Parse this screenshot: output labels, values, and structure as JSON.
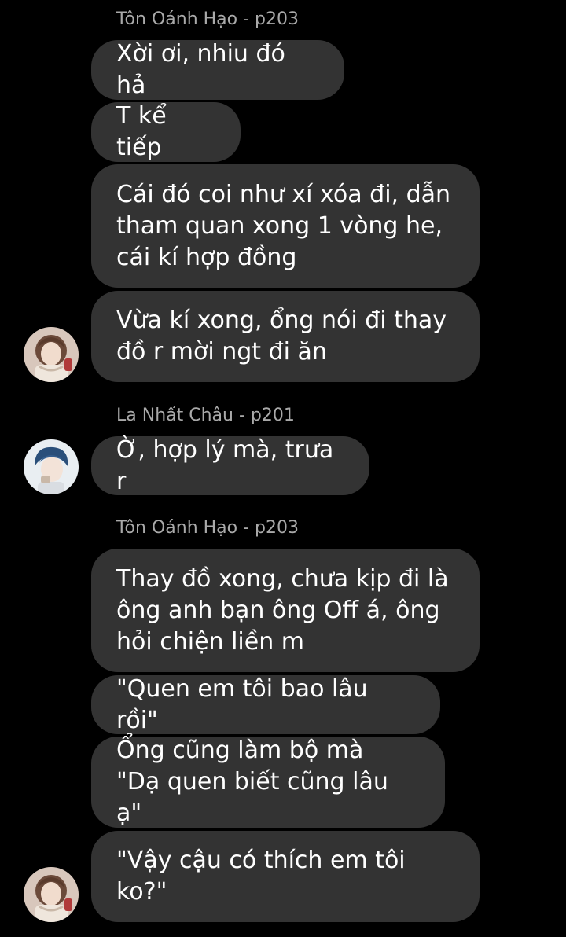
{
  "colors": {
    "background": "#000000",
    "bubble": "#333333",
    "sender_name": "#a9a9a9",
    "text": "#ffffff"
  },
  "groups": [
    {
      "sender": "Tôn Oánh Hạo - p203",
      "avatar": "avatar-girl-scarf",
      "messages": [
        "Xời ơi, nhiu đó hả",
        "T kể tiếp",
        "Cái đó coi như xí xóa đi, dẫn\ntham quan xong 1 vòng he,\ncái kí hợp đồng",
        "Vừa kí xong, ổng nói đi thay\nđồ r mời ngt đi ăn"
      ]
    },
    {
      "sender": "La Nhất Châu - p201",
      "avatar": "avatar-boy-blue-hair",
      "messages": [
        "Ờ, hợp lý mà, trưa r"
      ]
    },
    {
      "sender": "Tôn Oánh Hạo - p203",
      "avatar": "avatar-girl-scarf",
      "messages": [
        "Thay đồ xong, chưa kịp đi là\nông anh bạn ông Off á, ông\nhỏi chiện liền m",
        "\"Quen em tôi bao lâu rồi\"",
        "Ổng cũng làm bộ mà\n\"Dạ quen biết cũng lâu ạ\"",
        "\"Vậy cậu có thích em tôi\nko?\""
      ]
    }
  ]
}
